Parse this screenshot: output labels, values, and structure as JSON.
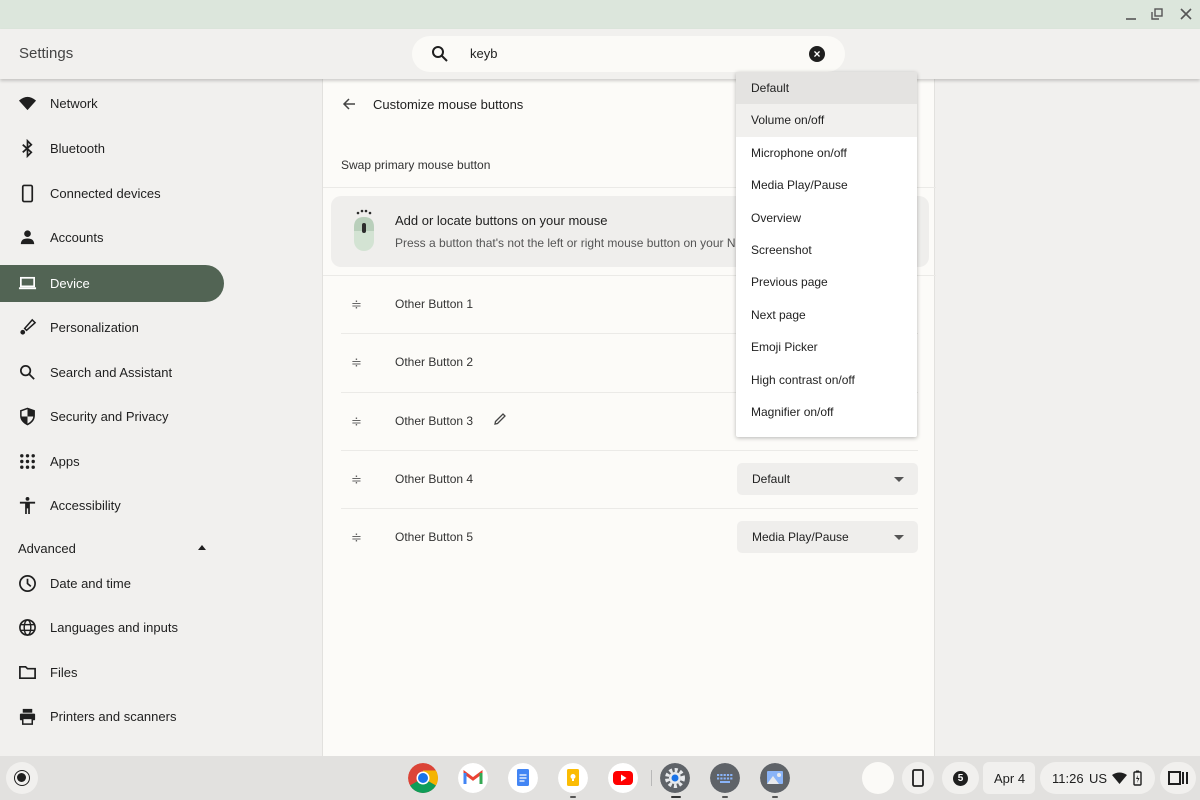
{
  "window": {
    "controls": [
      "minimize",
      "restore",
      "close"
    ]
  },
  "header": {
    "title": "Settings",
    "search": {
      "value": "keyb",
      "icon": "search-icon",
      "clear_icon": "clear-icon"
    }
  },
  "sidebar": {
    "items": [
      {
        "label": "Network",
        "icon": "wifi-icon"
      },
      {
        "label": "Bluetooth",
        "icon": "bluetooth-icon"
      },
      {
        "label": "Connected devices",
        "icon": "phone-icon"
      },
      {
        "label": "Accounts",
        "icon": "person-icon"
      },
      {
        "label": "Device",
        "icon": "laptop-icon",
        "active": true
      },
      {
        "label": "Personalization",
        "icon": "brush-icon"
      },
      {
        "label": "Search and Assistant",
        "icon": "search-icon"
      },
      {
        "label": "Security and Privacy",
        "icon": "shield-icon"
      },
      {
        "label": "Apps",
        "icon": "apps-grid-icon"
      },
      {
        "label": "Accessibility",
        "icon": "accessibility-icon"
      }
    ],
    "advanced_label": "Advanced",
    "advanced_items": [
      {
        "label": "Date and time",
        "icon": "clock-icon"
      },
      {
        "label": "Languages and inputs",
        "icon": "globe-icon"
      },
      {
        "label": "Files",
        "icon": "folder-icon"
      },
      {
        "label": "Printers and scanners",
        "icon": "printer-icon"
      }
    ]
  },
  "main": {
    "title": "Customize mouse buttons",
    "swap_label": "Swap primary mouse button",
    "info": {
      "title": "Add or locate buttons on your mouse",
      "description": "Press a button that's not the left or right mouse button on your N"
    },
    "buttons": [
      {
        "name": "Other Button 1",
        "value": ""
      },
      {
        "name": "Other Button 2",
        "value": ""
      },
      {
        "name": "Other Button 3",
        "value": "",
        "editable": true
      },
      {
        "name": "Other Button 4",
        "value": "Default"
      },
      {
        "name": "Other Button 5",
        "value": "Media Play/Pause"
      }
    ]
  },
  "dropdown": {
    "selected": "Default",
    "hovered": "Volume on/off",
    "options": [
      "Default",
      "Volume on/off",
      "Microphone on/off",
      "Media Play/Pause",
      "Overview",
      "Screenshot",
      "Previous page",
      "Next page",
      "Emoji Picker",
      "High contrast on/off",
      "Magnifier on/off"
    ]
  },
  "shelf": {
    "apps": [
      "Chrome",
      "Gmail",
      "Docs",
      "Keep",
      "YouTube",
      "Settings",
      "Keyboard",
      "Gallery"
    ],
    "notification_count": "5",
    "date": "Apr 4",
    "time": "11:26",
    "locale": "US"
  },
  "colors": {
    "accent": "#526454",
    "titlebar": "#dce6dc"
  }
}
